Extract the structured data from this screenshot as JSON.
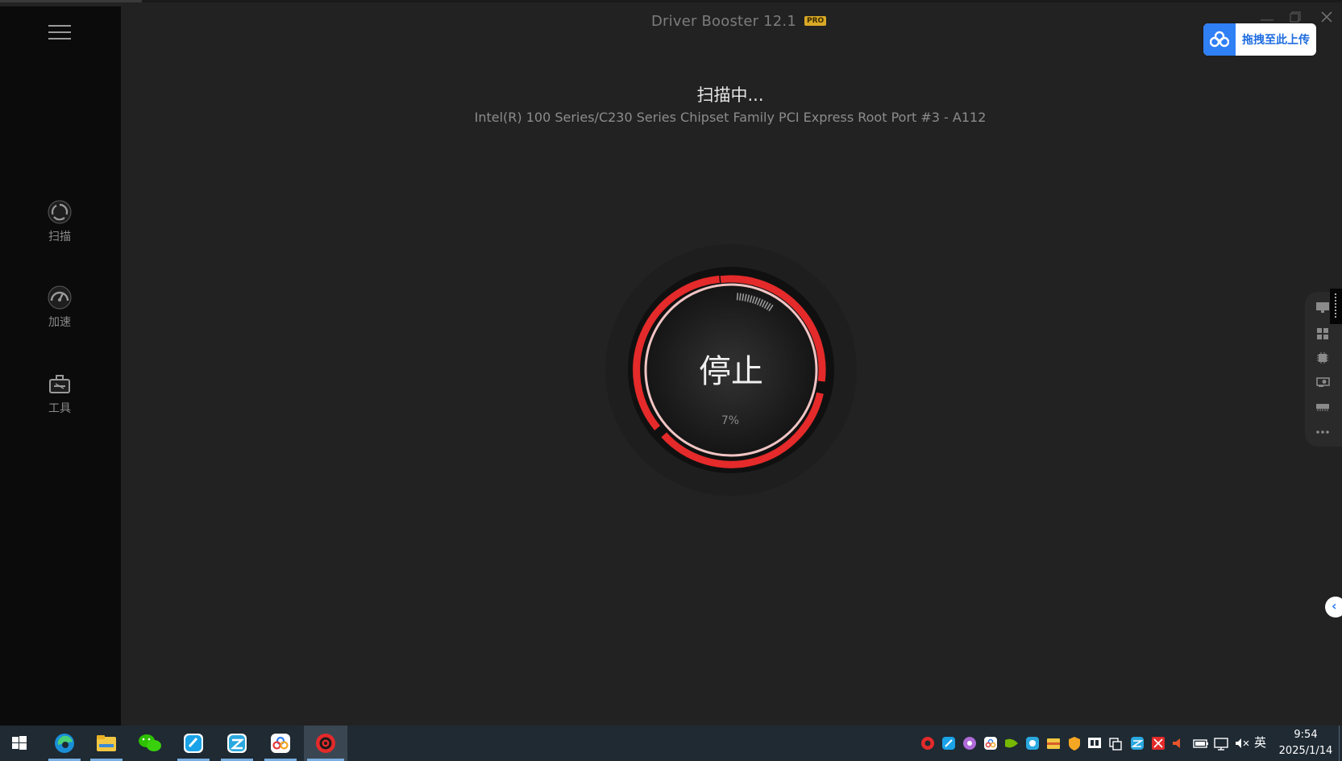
{
  "app": {
    "title": "Driver Booster 12.1",
    "badge": "PRO"
  },
  "sidebar": {
    "items": [
      {
        "label": "扫描",
        "icon": "scan-icon"
      },
      {
        "label": "加速",
        "icon": "speedometer-icon"
      },
      {
        "label": "工具",
        "icon": "toolbox-icon"
      }
    ]
  },
  "upload": {
    "label": "拖拽至此上传"
  },
  "scan": {
    "status": "扫描中...",
    "current_item": "Intel(R) 100 Series/C230 Series Chipset Family PCI Express Root Port #3 - A112",
    "button_label": "停止",
    "progress_text": "7%",
    "progress": 0.07
  },
  "right_panel": {
    "icons": [
      "monitor-icon",
      "windows-icon",
      "chip-icon",
      "graphics-card-icon",
      "memory-icon",
      "more-icon"
    ]
  },
  "taskbar": {
    "apps": [
      "start-icon",
      "edge-icon",
      "file-explorer-icon",
      "wechat-icon",
      "app-blue-icon",
      "app-cloud-icon",
      "baidu-netdisk-icon",
      "driver-booster-icon"
    ],
    "ime": "英",
    "time": "9:54",
    "date": "2025/1/14"
  },
  "colors": {
    "background": "#222222",
    "sidebar": "#0b0b0b",
    "accent_red": "#e42a2a",
    "accent_blue": "#2f7ff5"
  }
}
